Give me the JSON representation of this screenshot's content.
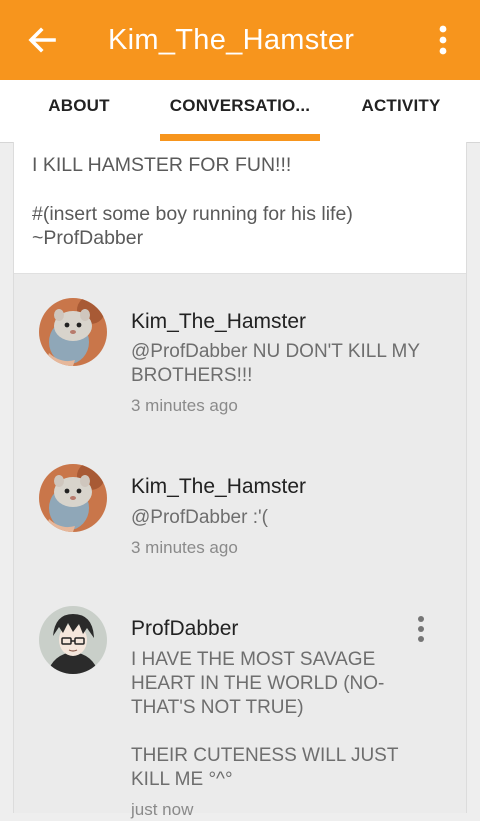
{
  "appbar": {
    "title": "Kim_The_Hamster",
    "back_icon": "arrow-left-icon",
    "more_icon": "more-vertical-icon",
    "color": "#f7951d"
  },
  "tabs": [
    {
      "label": "ABOUT",
      "active": false
    },
    {
      "label": "CONVERSATIO...",
      "active": true
    },
    {
      "label": "ACTIVITY",
      "active": false
    }
  ],
  "post": {
    "lines": [
      "I KILL HAMSTER FOR FUN!!!",
      "#(insert some boy running for his life)",
      "~ProfDabber"
    ]
  },
  "comments": [
    {
      "author": "Kim_The_Hamster",
      "text_lines": [
        "@ProfDabber NU DON'T KILL MY",
        "BROTHERS!!!"
      ],
      "time": "3 minutes ago",
      "avatar": "hamster-avatar"
    },
    {
      "author": "Kim_The_Hamster",
      "text_lines": [
        "@ProfDabber :'("
      ],
      "time": "3 minutes ago",
      "avatar": "hamster-avatar"
    },
    {
      "author": "ProfDabber",
      "text_lines": [
        "I HAVE THE MOST SAVAGE",
        "HEART IN THE WORLD (NO-",
        "THAT'S NOT TRUE)",
        "",
        "THEIR CUTENESS WILL JUST",
        "KILL ME °^°"
      ],
      "time": "just now",
      "avatar": "anime-boy-avatar",
      "more_icon": "more-vertical-icon"
    }
  ]
}
